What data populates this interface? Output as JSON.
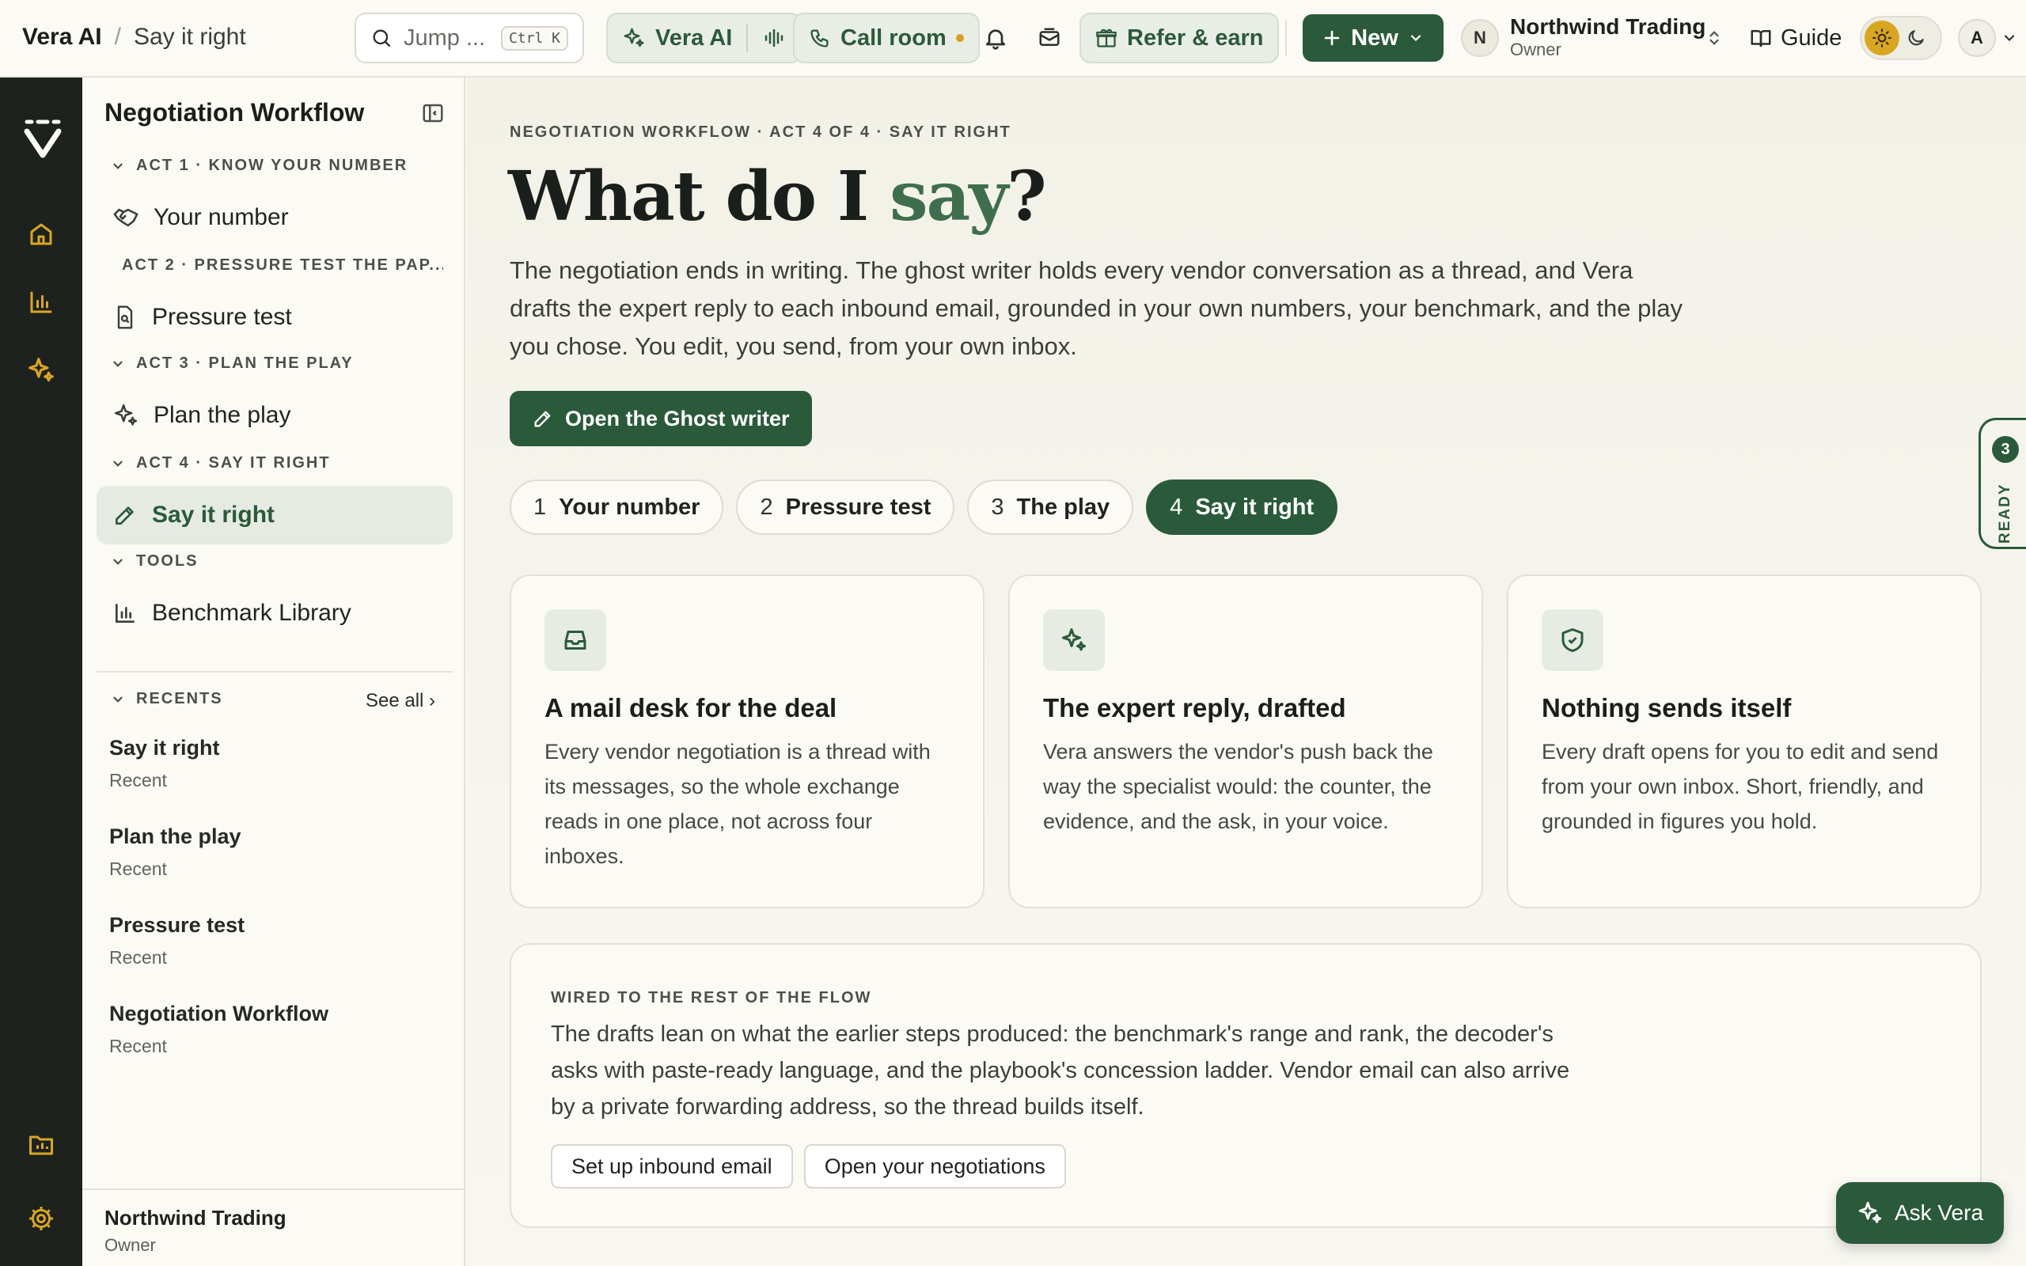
{
  "header": {
    "breadcrumb_root": "Vera AI",
    "breadcrumb_sep": "/",
    "breadcrumb_current": "Say it right",
    "search_placeholder": "Jump ...",
    "search_shortcut": "Ctrl K",
    "vera_ai_label": "Vera AI",
    "call_room_label": "Call room",
    "refer_label": "Refer & earn",
    "new_label": "New",
    "org_initial": "N",
    "org_name": "Northwind Trading",
    "org_role": "Owner",
    "guide_label": "Guide",
    "user_initial": "A"
  },
  "sidebar": {
    "title": "Negotiation Workflow",
    "acts": [
      {
        "label": "ACT 1 · KNOW YOUR NUMBER",
        "item": "Your number"
      },
      {
        "label": "ACT 2 · PRESSURE TEST THE PAP...",
        "item": "Pressure test"
      },
      {
        "label": "ACT 3 · PLAN THE PLAY",
        "item": "Plan the play"
      },
      {
        "label": "ACT 4 · SAY IT RIGHT",
        "item": "Say it right"
      },
      {
        "label": "TOOLS",
        "item": "Benchmark Library"
      }
    ],
    "recents_label": "RECENTS",
    "see_all": "See all ›",
    "recents": [
      {
        "name": "Say it right",
        "sub": "Recent"
      },
      {
        "name": "Plan the play",
        "sub": "Recent"
      },
      {
        "name": "Pressure test",
        "sub": "Recent"
      },
      {
        "name": "Negotiation Workflow",
        "sub": "Recent"
      }
    ],
    "footer_name": "Northwind Trading",
    "footer_role": "Owner"
  },
  "main": {
    "eyebrow": "NEGOTIATION WORKFLOW · ACT 4 OF 4 · SAY IT RIGHT",
    "headline_pre": "What do I ",
    "headline_accent": "say",
    "headline_post": "?",
    "lead": "The negotiation ends in writing. The ghost writer holds every vendor conversation as a thread, and Vera drafts the expert reply to each inbound email, grounded in your own numbers, your benchmark, and the play you chose. You edit, you send, from your own inbox.",
    "cta": "Open the Ghost writer",
    "steps": [
      {
        "num": "1",
        "label": "Your number"
      },
      {
        "num": "2",
        "label": "Pressure test"
      },
      {
        "num": "3",
        "label": "The play"
      },
      {
        "num": "4",
        "label": "Say it right"
      }
    ],
    "cards": [
      {
        "title": "A mail desk for the deal",
        "body": "Every vendor negotiation is a thread with its messages, so the whole exchange reads in one place, not across four inboxes."
      },
      {
        "title": "The expert reply, drafted",
        "body": "Vera answers the vendor's push back the way the specialist would: the counter, the evidence, and the ask, in your voice."
      },
      {
        "title": "Nothing sends itself",
        "body": "Every draft opens for you to edit and send from your own inbox. Short, friendly, and grounded in figures you hold."
      }
    ],
    "wired_eyebrow": "WIRED TO THE REST OF THE FLOW",
    "wired_body": "The drafts lean on what the earlier steps produced: the benchmark's range and rank, the decoder's asks with paste-ready language, and the playbook's concession ladder. Vendor email can also arrive by a private forwarding address, so the thread builds itself.",
    "wired_btn_1": "Set up inbound email",
    "wired_btn_2": "Open your negotiations"
  },
  "ready_tab": {
    "count": "3",
    "label": "READY"
  },
  "ask_vera": "Ask Vera",
  "colors": {
    "brand_green": "#2b5a3a",
    "accent_green": "#3f6e4c",
    "amber": "#d9a620",
    "rail": "#1d221e"
  }
}
